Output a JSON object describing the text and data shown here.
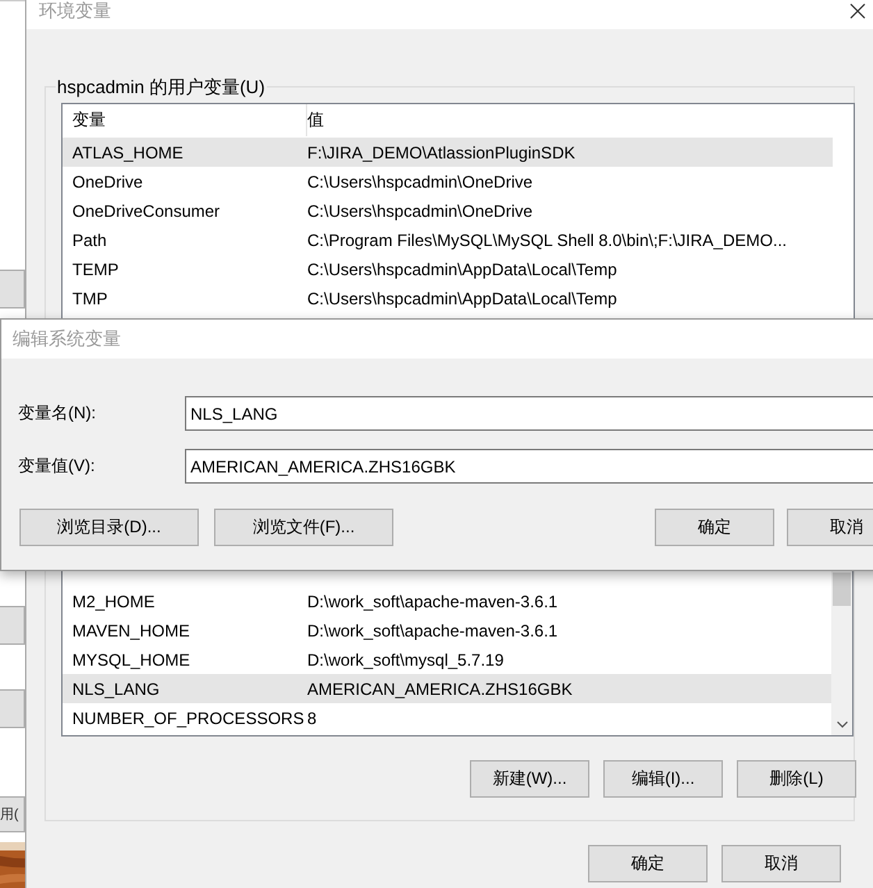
{
  "background_window": {
    "button_label": "用("
  },
  "main_window": {
    "title": "环境变量",
    "user_group": {
      "title": "hspcadmin 的用户变量(U)",
      "columns": [
        "变量",
        "值"
      ],
      "rows": [
        {
          "name": "ATLAS_HOME",
          "value": "F:\\JIRA_DEMO\\AtlassionPluginSDK",
          "selected": true
        },
        {
          "name": "OneDrive",
          "value": "C:\\Users\\hspcadmin\\OneDrive",
          "selected": false
        },
        {
          "name": "OneDriveConsumer",
          "value": "C:\\Users\\hspcadmin\\OneDrive",
          "selected": false
        },
        {
          "name": "Path",
          "value": "C:\\Program Files\\MySQL\\MySQL Shell 8.0\\bin\\;F:\\JIRA_DEMO...",
          "selected": false
        },
        {
          "name": "TEMP",
          "value": "C:\\Users\\hspcadmin\\AppData\\Local\\Temp",
          "selected": false
        },
        {
          "name": "TMP",
          "value": "C:\\Users\\hspcadmin\\AppData\\Local\\Temp",
          "selected": false
        }
      ]
    },
    "system_table": {
      "rows": [
        {
          "name": "M2_HOME",
          "value": "D:\\work_soft\\apache-maven-3.6.1",
          "selected": false
        },
        {
          "name": "MAVEN_HOME",
          "value": "D:\\work_soft\\apache-maven-3.6.1",
          "selected": false
        },
        {
          "name": "MYSQL_HOME",
          "value": "D:\\work_soft\\mysql_5.7.19",
          "selected": false
        },
        {
          "name": "NLS_LANG",
          "value": "AMERICAN_AMERICA.ZHS16GBK",
          "selected": true
        },
        {
          "name": "NUMBER_OF_PROCESSORS",
          "value": "8",
          "selected": false
        }
      ]
    },
    "system_buttons": [
      "新建(W)...",
      "编辑(I)...",
      "删除(L)"
    ],
    "buttons": [
      "确定",
      "取消"
    ]
  },
  "edit_dialog": {
    "title": "编辑系统变量",
    "fields": [
      {
        "label": "变量名(N):",
        "value": "NLS_LANG"
      },
      {
        "label": "变量值(V):",
        "value": "AMERICAN_AMERICA.ZHS16GBK"
      }
    ],
    "browse_buttons": [
      "浏览目录(D)...",
      "浏览文件(F)..."
    ],
    "buttons": [
      "确定",
      "取消"
    ]
  }
}
